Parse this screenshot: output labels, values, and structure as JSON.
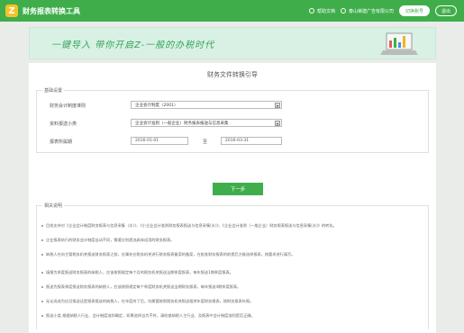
{
  "app": {
    "title": "财务报表转换工具",
    "logo": "Z"
  },
  "topbar": {
    "links": [
      {
        "label": "帮助文档",
        "icon": "help-icon"
      },
      {
        "label": "泰山荣建广告有限公司",
        "icon": "user-icon"
      }
    ],
    "switch_label": "切换账号",
    "exit_label": "退出"
  },
  "banner": {
    "text": "一键导入  带你开启Z-一般的办税时代"
  },
  "page": {
    "title": "财务文件转换引导"
  },
  "basic": {
    "section_label": "基础设置",
    "standard_label": "财务会计制度准则",
    "standard_value": "企业会计制度（2001）",
    "type_label": "资料报送小类",
    "type_value": "企业会计准则（一般企业）财务报表报送与信息采集",
    "period_label": "报表所属期",
    "date_from": "2016-01-01",
    "date_sep": "至",
    "date_to": "2016-03-31"
  },
  "next_label": "下一步",
  "notes": {
    "section_label": "相关说明",
    "items": [
      "目前支持对《企业会计制度财务报表与信息采集（水）》、《小企业会计准则财务报表报送与信息采集(水)》、《企业会计准则（一般企业）财务报表报送与信息采集(水)》的转化。",
      "企业报表执行的财务会计制度自动不同，需要分别提选具体适用的财务报表。",
      "纳税人在向主管税务机关报送财务报表之前，应事先在税务机关进行财务报表备案的备案，在批准财务报表的前提后方能选择报表，按要求进行填写。",
      "填报为季度报送财务报表的纳税人，应该按照规定每个月的税务机关报送当期季度报表，每年报送1期季度报表。",
      "报送为报表季度报送财务报表的纳税人，应该按照规定每个季度财务机关报送当期财务报表，每年报送4期季度报表。",
      "无论选选为应月报送还是报表报送的纳税人，在年度终了后，均需要按照税务机关报送相关年度财务报表，按财务报表年报。",
      "报送小类  根据纳税人行业、会计制度准则确定，如果选择当为不符，请检查纳税人主行业、及报表中会计制度准则是否正确。"
    ]
  }
}
